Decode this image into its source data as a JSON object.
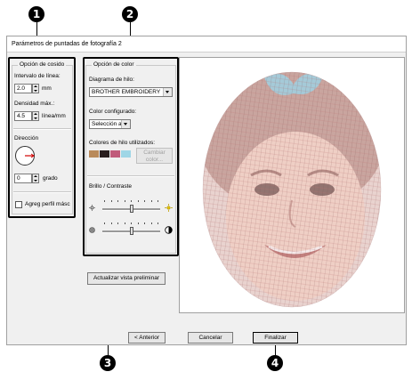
{
  "dialog": {
    "title": "Parámetros de puntadas de fotografía 2"
  },
  "callouts": [
    "1",
    "2",
    "3",
    "4"
  ],
  "sewing": {
    "legend": "Opción de cosido",
    "line_interval_label": "Intervalo de línea:",
    "line_interval_value": "2.0",
    "line_interval_unit": "mm",
    "max_density_label": "Densidad máx.:",
    "max_density_value": "4.5",
    "max_density_unit": "línea/mm",
    "direction_label": "Dirección",
    "direction_value": "0",
    "direction_unit": "grado",
    "mask_checkbox_label": "Agreg perfil másc",
    "mask_checked": false
  },
  "color": {
    "legend": "Opción de color",
    "thread_chart_label": "Diagrama de hilo:",
    "thread_chart_value": "BROTHER EMBROIDERY",
    "configured_label": "Color configurado:",
    "configured_value": "Selección a",
    "used_colors_label": "Colores de hilo utilizados:",
    "swatches": [
      "#b98a5a",
      "#2a1f1f",
      "#c05a7a",
      "#9fd6e6"
    ],
    "change_color_label": "Cambiar color...",
    "brightness_label": "Brillo / Contraste",
    "brightness_level": 0.5,
    "contrast_level": 0.5
  },
  "buttons": {
    "update_preview": "Actualizar vista preliminar",
    "back": "< Anterior",
    "cancel": "Cancelar",
    "finish": "Finalizar"
  }
}
